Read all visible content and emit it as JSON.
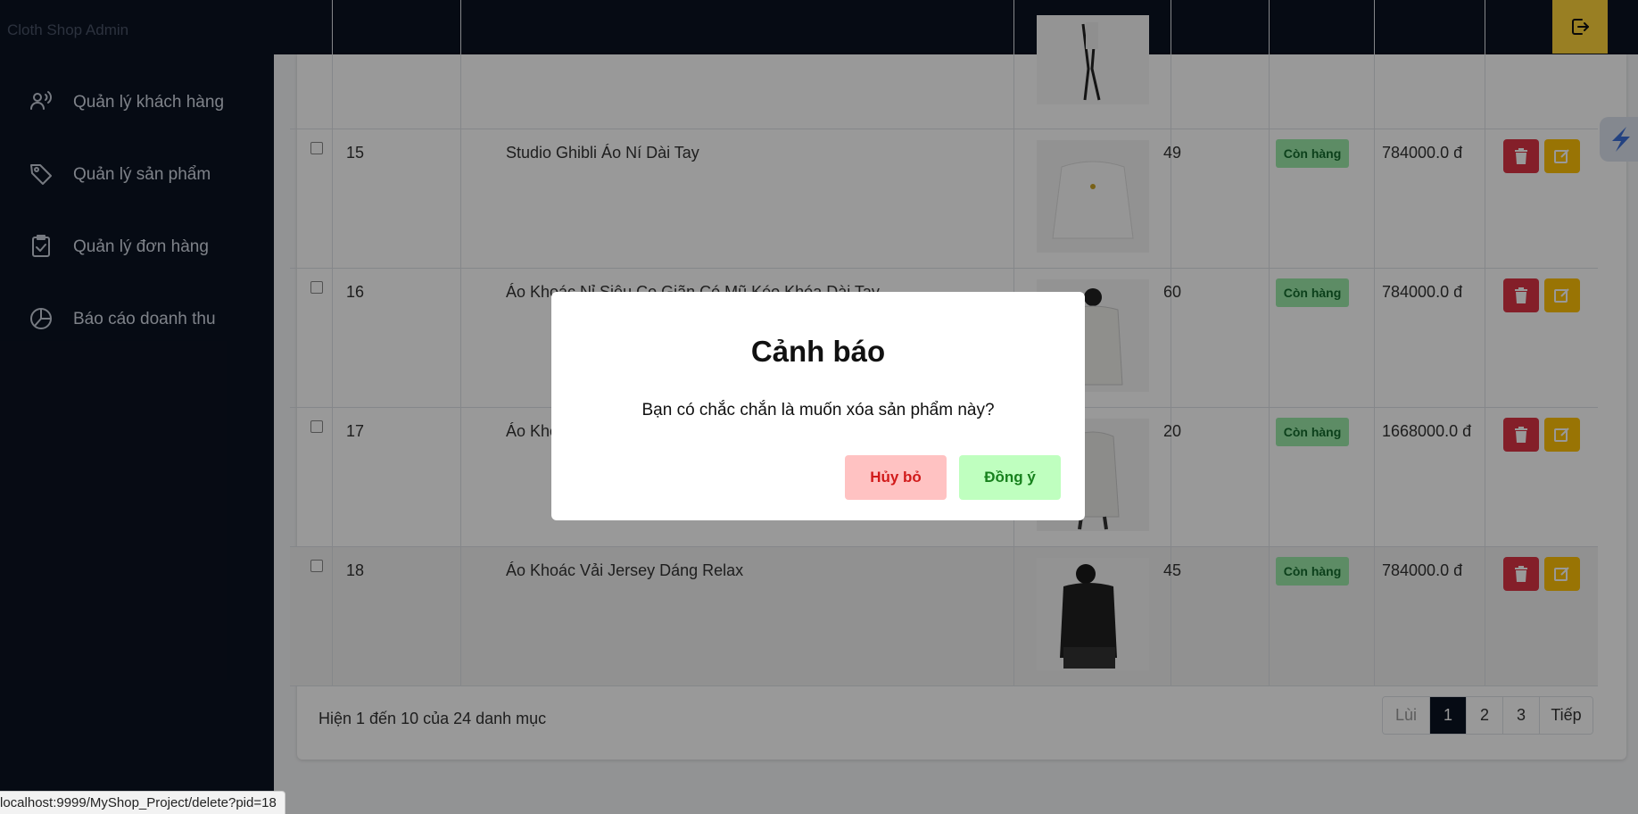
{
  "app": {
    "brand": "Cloth Shop Admin"
  },
  "sidebar": {
    "items": [
      {
        "label": "Quản lý khách hàng",
        "icon": "users-icon"
      },
      {
        "label": "Quản lý sản phẩm",
        "icon": "tag-icon"
      },
      {
        "label": "Quản lý đơn hàng",
        "icon": "clipboard-check-icon"
      },
      {
        "label": "Báo cáo doanh thu",
        "icon": "pie-chart-icon"
      }
    ]
  },
  "products": [
    {
      "id": "15",
      "name": "Studio Ghibli Áo Ní Dài Tay",
      "qty": "49",
      "status": "Còn hàng",
      "price": "784000.0 đ"
    },
    {
      "id": "16",
      "name": "Áo Khoác Nỉ Siêu Co Giãn Có Mũ Kéo Khóa Dài Tay",
      "qty": "60",
      "status": "Còn hàng",
      "price": "784000.0 đ"
    },
    {
      "id": "17",
      "name": "Áo Khoác",
      "qty": "20",
      "status": "Còn hàng",
      "price": "1668000.0 đ"
    },
    {
      "id": "18",
      "name": "Áo Khoác Vải Jersey Dáng Relax",
      "qty": "45",
      "status": "Còn hàng",
      "price": "784000.0 đ"
    }
  ],
  "footer": {
    "summary": "Hiện 1 đến 10 của 24 danh mục"
  },
  "pagination": {
    "prev": "Lùi",
    "pages": [
      "1",
      "2",
      "3"
    ],
    "active": "1",
    "next": "Tiếp"
  },
  "modal": {
    "title": "Cảnh báo",
    "message": "Bạn có chắc chắn là muốn xóa sản phẩm này?",
    "cancel": "Hủy bỏ",
    "confirm": "Đồng ý"
  },
  "statusbar": {
    "url": "localhost:9999/MyShop_Project/delete?pid=18"
  },
  "colors": {
    "sidebar": "#0b1322",
    "accent": "#ffd43b",
    "danger": "#dc3545",
    "warning": "#ffc107",
    "success_badge": "#9be9a8"
  }
}
